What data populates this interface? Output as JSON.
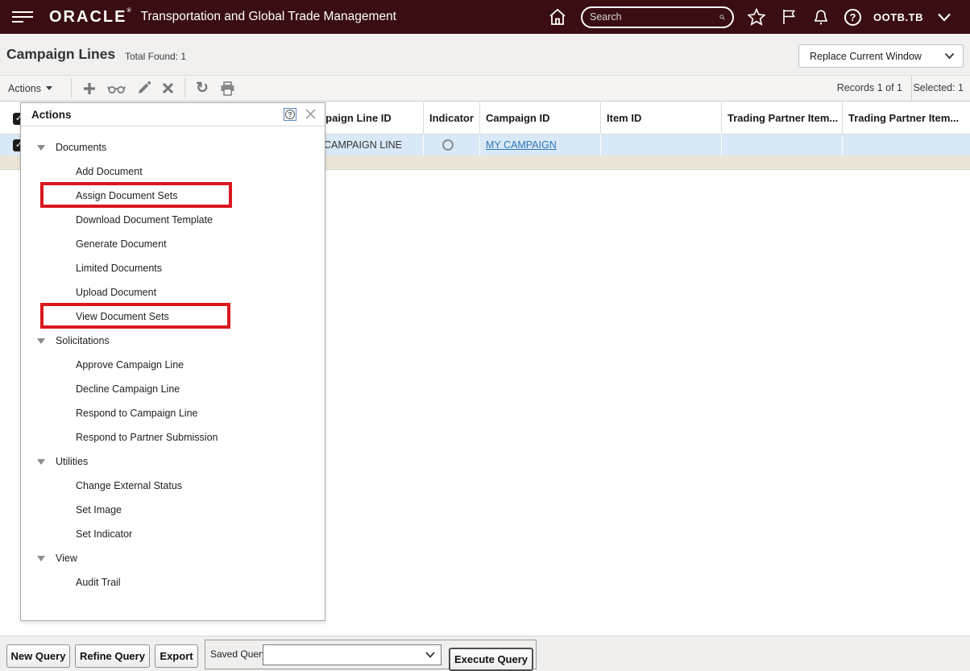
{
  "topbar": {
    "brand": "ORACLE",
    "registered_mark": "®",
    "app_title": "Transportation and Global Trade Management",
    "search_placeholder": "Search",
    "username": "OOTB.TB"
  },
  "page_header": {
    "title": "Campaign Lines",
    "total_found": "Total Found: 1",
    "window_target_selector": "Replace Current Window"
  },
  "toolbar": {
    "actions_label": "Actions",
    "records_text": "Records 1 of 1",
    "selected_text": "Selected: 1"
  },
  "grid": {
    "columns": [
      "Campaign Line ID",
      "Indicator",
      "Campaign ID",
      "Item ID",
      "Trading Partner Item...",
      "Trading Partner Item..."
    ],
    "row": {
      "campaign_line_id": "MY CAMPAIGN LINE",
      "campaign_id_link": "MY CAMPAIGN"
    }
  },
  "actions_popup": {
    "title": "Actions",
    "sections": [
      {
        "label": "Documents",
        "items": [
          "Add Document",
          "Assign Document Sets",
          "Download Document Template",
          "Generate Document",
          "Limited Documents",
          "Upload Document",
          "View Document Sets"
        ]
      },
      {
        "label": "Solicitations",
        "items": [
          "Approve Campaign Line",
          "Decline Campaign Line",
          "Respond to Campaign Line",
          "Respond to Partner Submission"
        ]
      },
      {
        "label": "Utilities",
        "items": [
          "Change External Status",
          "Set Image",
          "Set Indicator"
        ]
      },
      {
        "label": "View",
        "items": [
          "Audit Trail"
        ]
      }
    ],
    "highlighted_items": [
      "Assign Document Sets",
      "View Document Sets"
    ]
  },
  "query_footer": {
    "new_query": "New Query",
    "refine_query": "Refine Query",
    "export": "Export",
    "saved_query_label": "Saved Query:",
    "saved_query_value": "",
    "execute_query": "Execute Query"
  },
  "icons": {
    "check": "✓",
    "refresh": "↻",
    "help": "?"
  },
  "colors": {
    "topbar_bg": "#390d11",
    "selected_row_bg": "#d9e9f7",
    "link_blue": "#2e75b6",
    "highlight_red": "#d8181e",
    "empty_row_beige": "#ebe7d8"
  }
}
